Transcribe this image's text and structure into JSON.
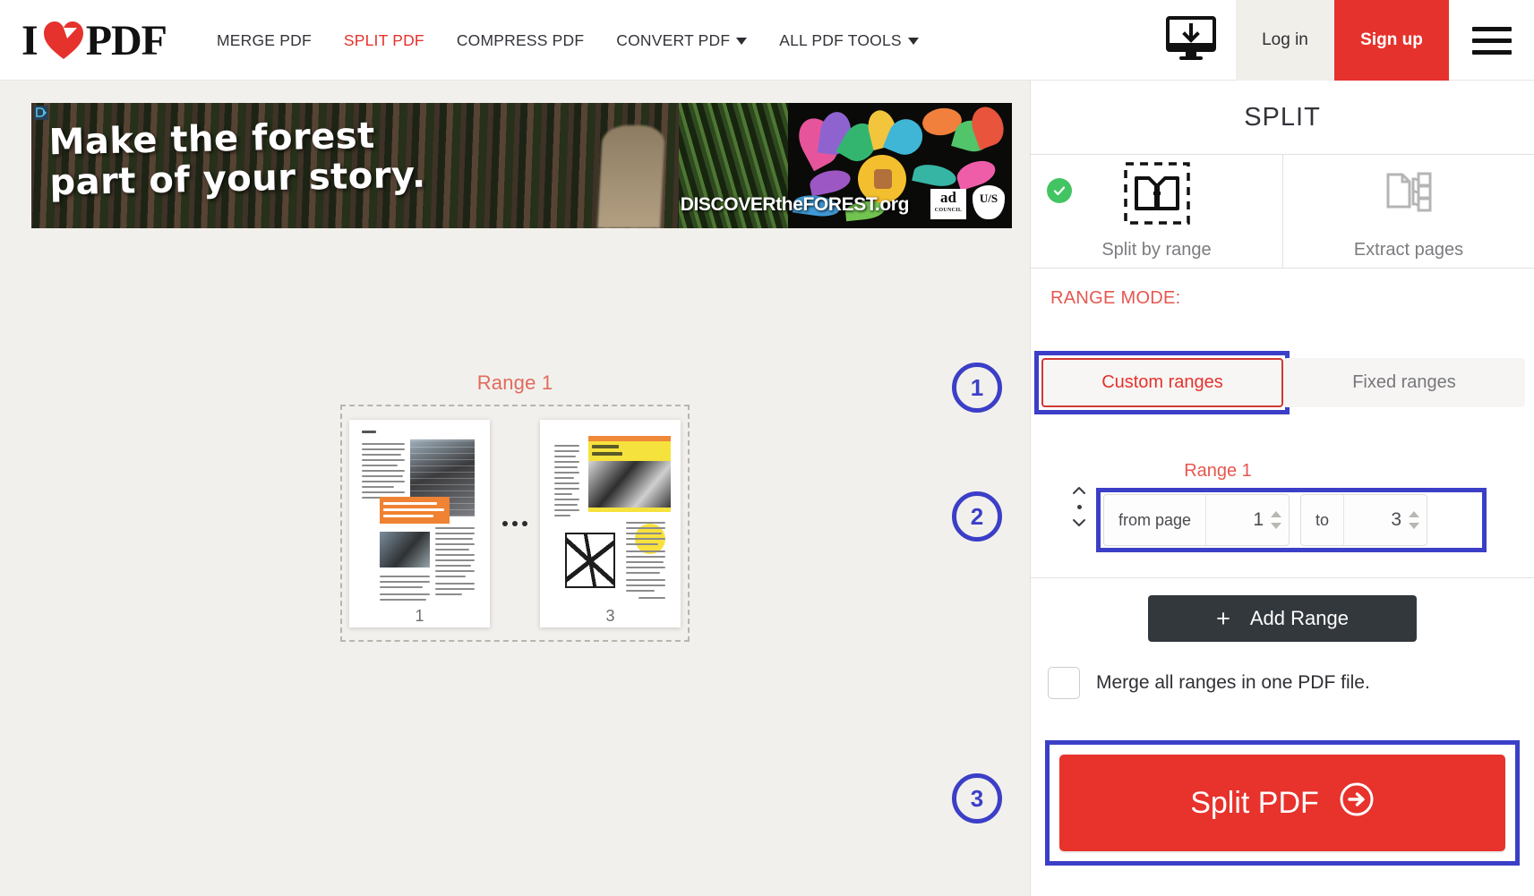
{
  "header": {
    "logo": {
      "text_left": "I",
      "text_right": "PDF",
      "heart_icon": "heart-icon"
    },
    "nav": [
      {
        "label": "MERGE PDF",
        "active": false,
        "has_caret": false
      },
      {
        "label": "SPLIT PDF",
        "active": true,
        "has_caret": false
      },
      {
        "label": "COMPRESS PDF",
        "active": false,
        "has_caret": false
      },
      {
        "label": "CONVERT PDF",
        "active": false,
        "has_caret": true
      },
      {
        "label": "ALL PDF TOOLS",
        "active": false,
        "has_caret": true
      }
    ],
    "desktop_icon": "desktop-download-icon",
    "login_label": "Log in",
    "signup_label": "Sign up",
    "menu_icon": "hamburger-menu-icon"
  },
  "ad": {
    "headline_line1": "Make the forest",
    "headline_line2": "part of your story.",
    "brand": "DISCOVERtheFOREST.org",
    "ad_council": "ad",
    "ad_council_sub": "COUNCIL",
    "usfs": "U/S",
    "adchoices_icon": "adchoices-icon"
  },
  "preview": {
    "range_title": "Range 1",
    "pages": [
      {
        "number": "1"
      },
      {
        "number": "3"
      }
    ],
    "ellipsis_icon": "ellipsis-icon"
  },
  "panel": {
    "title": "SPLIT",
    "tabs": [
      {
        "label": "Split by range",
        "icon": "split-by-range-icon",
        "selected": true,
        "check_icon": "check-circle-icon"
      },
      {
        "label": "Extract pages",
        "icon": "extract-pages-icon",
        "selected": false
      }
    ],
    "range_mode_label": "RANGE MODE:",
    "mode_options": [
      {
        "label": "Custom ranges",
        "active": true
      },
      {
        "label": "Fixed ranges",
        "active": false
      }
    ],
    "range_label": "Range 1",
    "range_inputs": {
      "from_label": "from page",
      "from_value": "1",
      "to_label": "to",
      "to_value": "3",
      "sorter_icon": "drag-sort-icon",
      "spinner_up_icon": "spinner-up-icon",
      "spinner_down_icon": "spinner-down-icon"
    },
    "add_range_label": "Add Range",
    "add_range_plus": "+",
    "merge_checkbox_label": "Merge all ranges in one PDF file.",
    "merge_checked": false,
    "split_button_label": "Split PDF",
    "split_button_icon": "arrow-right-circle-icon"
  },
  "annotations": {
    "steps": [
      {
        "number": "1"
      },
      {
        "number": "2"
      },
      {
        "number": "3"
      }
    ],
    "highlight_color": "#3b3fc7"
  },
  "colors": {
    "brand_red": "#e5322d",
    "accent_red": "#e5574f",
    "highlight_blue": "#3b3fc7",
    "dark_button": "#33383d",
    "check_green": "#43c463",
    "page_bg": "#f2f0ec"
  }
}
